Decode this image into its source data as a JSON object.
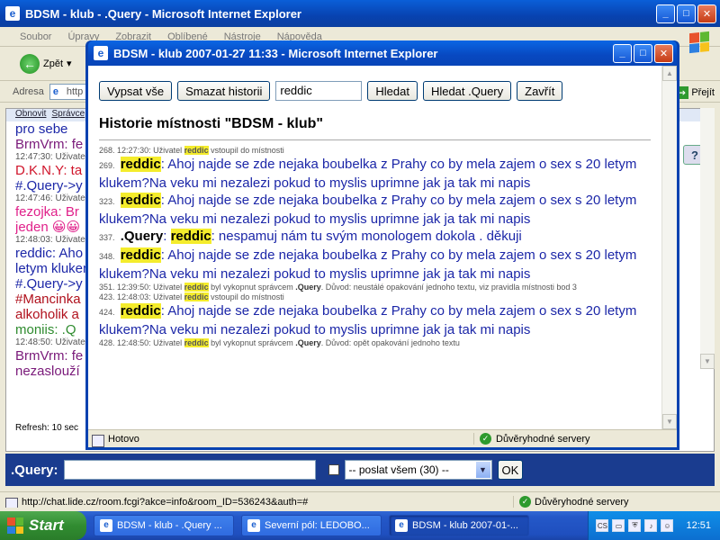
{
  "main_window": {
    "title": "BDSM - klub - .Query - Microsoft Internet Explorer",
    "menu": [
      "Soubor",
      "Úpravy",
      "Zobrazit",
      "Oblíbené",
      "Nástroje",
      "Nápověda"
    ],
    "back_label": "Zpět",
    "address_label": "Adresa",
    "address_value": "http",
    "go_label": "Přejít",
    "chat_top_links": [
      "Obnovit",
      "Správce"
    ],
    "chat_lines": [
      {
        "text": "pro sebe",
        "color": "#1c27a8",
        "size": "big"
      },
      {
        "text": "BrmVrm: fe",
        "color": "#7a1a7a",
        "size": "big"
      },
      {
        "text": "12:47:30: Uživatel",
        "color": "#555555",
        "size": "small"
      },
      {
        "text": "D.K.N.Y: ta",
        "color": "#d0142a",
        "size": "big"
      },
      {
        "text": "#.Query->y",
        "color": "#1c27a8",
        "size": "big"
      },
      {
        "text": "12:47:46: Uživatel",
        "color": "#555555",
        "size": "small"
      },
      {
        "text": "fezojka: Br",
        "color": "#e0208a",
        "size": "big"
      },
      {
        "text": "jeden 😀😀",
        "color": "#e0208a",
        "size": "big"
      },
      {
        "text": "12:48:03: Uživatel",
        "color": "#555555",
        "size": "small"
      },
      {
        "text": "reddic: Aho",
        "color": "#1c27a8",
        "size": "big"
      },
      {
        "text": "letym kluken",
        "color": "#1c27a8",
        "size": "big"
      },
      {
        "text": "#.Query->y",
        "color": "#1c27a8",
        "size": "big"
      },
      {
        "text": "#Mancinka",
        "color": "#b0101c",
        "size": "big"
      },
      {
        "text": "alkoholik a",
        "color": "#b0101c",
        "size": "big"
      },
      {
        "text": "moniis: .Q",
        "color": "#2e8b2e",
        "size": "big"
      },
      {
        "text": "12:48:50: Uživatel",
        "color": "#555555",
        "size": "small"
      },
      {
        "text": "BrmVrm: fe",
        "color": "#7a1a7a",
        "size": "big"
      },
      {
        "text": "nezaslouží",
        "color": "#7a1a7a",
        "size": "big"
      }
    ],
    "refresh": "Refresh: 10 sec",
    "send": {
      "label": ".Query:",
      "input_value": "",
      "select_value": "-- poslat všem (30) --",
      "ok_label": "OK"
    },
    "status_url": "http://chat.lide.cz/room.fcgi?akce=info&room_ID=536243&auth=#",
    "status_zone": "Důvěryhodné servery"
  },
  "popup": {
    "title": "BDSM - klub 2007-01-27 11:33 - Microsoft Internet Explorer",
    "buttons": {
      "show_all": "Vypsat vše",
      "clear_history": "Smazat historii",
      "search": "Hledat",
      "search_query": "Hledat .Query",
      "close": "Zavřít"
    },
    "search_value": "reddic",
    "history_title": "Historie místnosti \"BDSM - klub\"",
    "entries": [
      {
        "type": "note",
        "num": "268.",
        "time": "12:27:30:",
        "pre": "Uživatel",
        "nick": "reddic",
        "post": "vstoupil do místnosti"
      },
      {
        "type": "msg",
        "num": "269.",
        "nick": "reddic",
        "text": ": Ahoj najde se zde nejaka boubelka z Prahy co by mela zajem o sex s 20 letym klukem?Na veku mi nezalezi pokud to myslis uprimne jak ja tak mi napis"
      },
      {
        "type": "msg",
        "num": "323.",
        "nick": "reddic",
        "text": ": Ahoj najde se zde nejaka boubelka z Prahy co by mela zajem o sex s 20 letym klukem?Na veku mi nezalezi pokud to myslis uprimne jak ja tak mi napis"
      },
      {
        "type": "msg2",
        "num": "337.",
        "from": ".Query",
        "sep": ": ",
        "nick": "reddic",
        "text": ": nespamuj nám tu svým monologem dokola . děkuji"
      },
      {
        "type": "msg",
        "num": "348.",
        "nick": "reddic",
        "text": ": Ahoj najde se zde nejaka boubelka z Prahy co by mela zajem o sex s 20 letym klukem?Na veku mi nezalezi pokud to myslis uprimne jak ja tak mi napis"
      },
      {
        "type": "kick",
        "num": "351.",
        "time": "12:39:50:",
        "pre": "Uživatel",
        "nick": "reddic",
        "mid": "byl vykopnut správcem",
        "admin": ".Query",
        "post": ". Důvod: neustálé opakování jednoho textu, viz pravidla místnosti bod 3"
      },
      {
        "type": "note",
        "num": "423.",
        "time": "12:48:03:",
        "pre": "Uživatel",
        "nick": "reddic",
        "post": "vstoupil do místnosti"
      },
      {
        "type": "msg",
        "num": "424.",
        "nick": "reddic",
        "text": ": Ahoj najde se zde nejaka boubelka z Prahy co by mela zajem o sex s 20 letym klukem?Na veku mi nezalezi pokud to myslis uprimne jak ja tak mi napis"
      },
      {
        "type": "kick",
        "num": "428.",
        "time": "12:48:50:",
        "pre": "Uživatel",
        "nick": "reddic",
        "mid": "byl vykopnut správcem",
        "admin": ".Query",
        "post": ". Důvod: opět opakování jednoho textu"
      }
    ],
    "status_left": "Hotovo",
    "status_zone": "Důvěryhodné servery"
  },
  "taskbar": {
    "start_label": "Start",
    "tasks": [
      {
        "label": "BDSM - klub - .Query ...",
        "active": false
      },
      {
        "label": "Severní pól: LEDOBO...",
        "active": false
      },
      {
        "label": "BDSM - klub 2007-01-...",
        "active": true
      }
    ],
    "clock": "12:51"
  },
  "colors": {
    "highlight": "#f4ec2c",
    "message_blue": "#1c27a8",
    "titlebar": "#0a5fd8"
  }
}
